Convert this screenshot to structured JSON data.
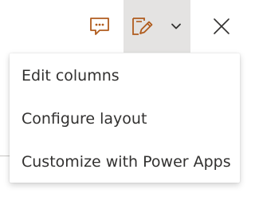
{
  "toolbar": {
    "comment_icon": "comment-icon",
    "edit_icon": "edit-view-icon",
    "chevron_icon": "chevron-down-icon",
    "close_icon": "close-icon"
  },
  "menu": {
    "items": [
      {
        "label": "Edit columns"
      },
      {
        "label": "Configure layout"
      },
      {
        "label": "Customize with Power Apps"
      }
    ]
  },
  "colors": {
    "accent": "#b05c1e",
    "selected_bg": "#e4e3e2",
    "text": "#323130"
  }
}
